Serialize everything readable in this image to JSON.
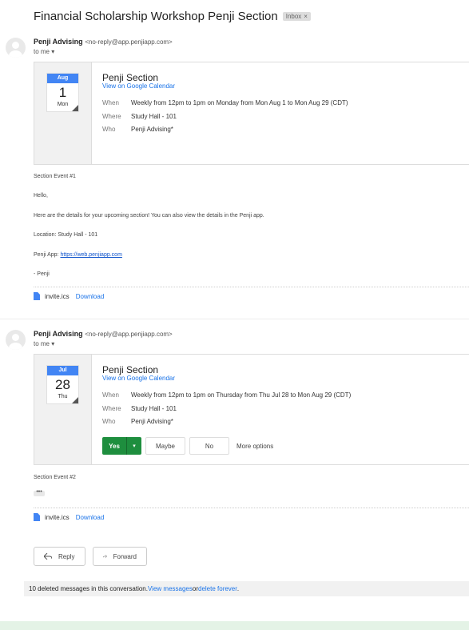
{
  "subject": {
    "title": "Financial Scholarship Workshop Penji Section",
    "label": "Inbox",
    "label_close": "×"
  },
  "messages": [
    {
      "sender_name": "Penji Advising",
      "sender_email": "<no-reply@app.penjiapp.com>",
      "to": "to me",
      "invite": {
        "month": "Aug",
        "day": "1",
        "dow": "Mon",
        "title": "Penji Section",
        "calendar_link": "View on Google Calendar",
        "when_label": "When",
        "when": "Weekly from 12pm to 1pm on Monday from Mon Aug 1 to Mon Aug 29 (CDT)",
        "where_label": "Where",
        "where": "Study Hall - 101",
        "who_label": "Who",
        "who": "Penji Advising*"
      },
      "body": {
        "line1": "Section Event #1",
        "line2": "Hello,",
        "line3": "Here are the details for your upcoming section! You can also view the details in the Penji app.",
        "line4": "Location: Study Hall - 101",
        "line5_prefix": "Penji App: ",
        "line5_link": "https://web.penjiapp.com",
        "line6": "- Penji"
      },
      "attachment": {
        "name": "invite.ics",
        "download": "Download"
      }
    },
    {
      "sender_name": "Penji Advising",
      "sender_email": "<no-reply@app.penjiapp.com>",
      "to": "to me",
      "invite": {
        "month": "Jul",
        "day": "28",
        "dow": "Thu",
        "title": "Penji Section",
        "calendar_link": "View on Google Calendar",
        "when_label": "When",
        "when": "Weekly from 12pm to 1pm on Thursday from Thu Jul 28 to Mon Aug 29 (CDT)",
        "where_label": "Where",
        "where": "Study Hall - 101",
        "who_label": "Who",
        "who": "Penji Advising*",
        "rsvp": {
          "yes": "Yes",
          "maybe": "Maybe",
          "no": "No",
          "more": "More options"
        }
      },
      "body": {
        "line1": "Section Event #2",
        "ellipsis": "•••"
      },
      "attachment": {
        "name": "invite.ics",
        "download": "Download"
      }
    }
  ],
  "actions": {
    "reply": "Reply",
    "forward": "Forward"
  },
  "deleted": {
    "text": "10 deleted messages in this conversation. ",
    "view": "View messages",
    "or": " or ",
    "delete": "delete forever",
    "end": "."
  },
  "colors": {
    "accent": "#1a73e8",
    "yes_green": "#1e8e3e",
    "calendar_blue": "#4285f4"
  }
}
